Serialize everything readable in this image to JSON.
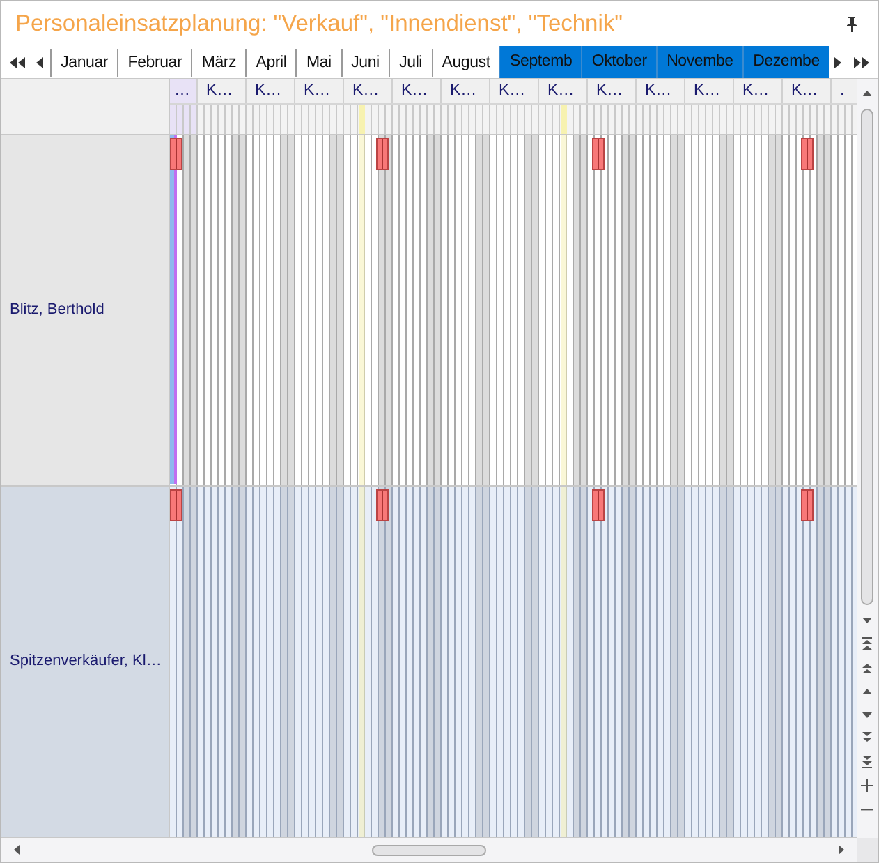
{
  "window": {
    "title": "Personaleinsatzplanung: \"Verkauf\", \"Innendienst\", \"Technik\""
  },
  "months": [
    {
      "label": "Januar",
      "selected": false
    },
    {
      "label": "Februar",
      "selected": false
    },
    {
      "label": "März",
      "selected": false
    },
    {
      "label": "April",
      "selected": false
    },
    {
      "label": "Mai",
      "selected": false
    },
    {
      "label": "Juni",
      "selected": false
    },
    {
      "label": "Juli",
      "selected": false
    },
    {
      "label": "August",
      "selected": false
    },
    {
      "label": "Septemb",
      "selected": true
    },
    {
      "label": "Oktober",
      "selected": true
    },
    {
      "label": "Novembe",
      "selected": true
    },
    {
      "label": "Dezembe",
      "selected": true
    }
  ],
  "week_headers": [
    "…",
    "K…",
    "K…",
    "K…",
    "K…",
    "K…",
    "K…",
    "K…",
    "K…",
    "K…",
    "K…",
    "K…",
    "K…",
    "K…",
    "."
  ],
  "rows": [
    {
      "name": "Blitz, Berthold"
    },
    {
      "name": "Spitzenverkäufer, Kl…"
    }
  ]
}
